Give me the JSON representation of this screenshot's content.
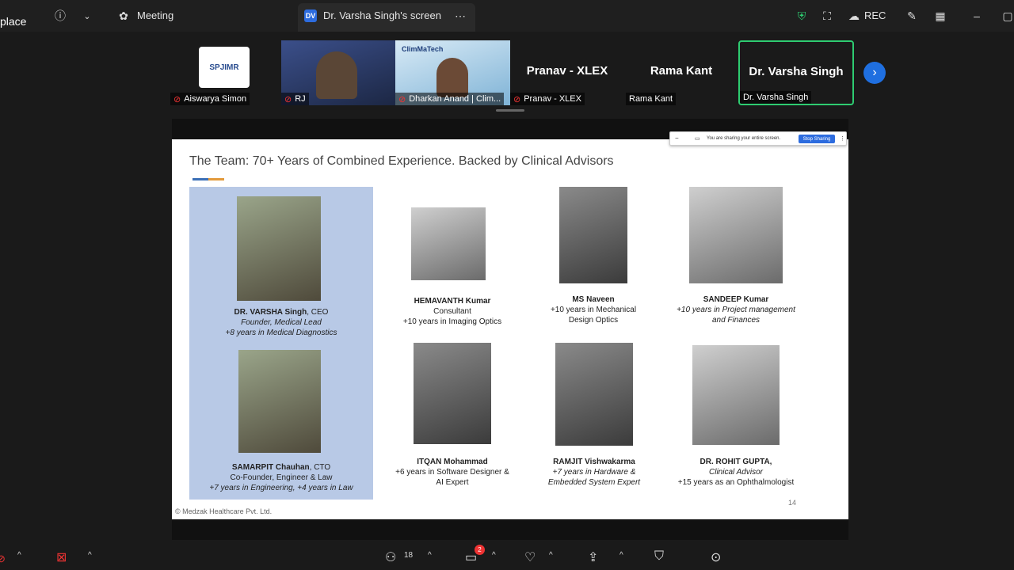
{
  "topbar": {
    "app_label": "place",
    "meeting_label": "Meeting",
    "screen_tab": {
      "badge": "DV",
      "label": "Dr.  Varsha Singh's screen"
    },
    "rec_label": "REC"
  },
  "participants": [
    {
      "name": "Aiswarya Simon",
      "muted": true,
      "logo_text": "SPJIMR"
    },
    {
      "name": "RJ",
      "muted": true
    },
    {
      "name": "Dharkan Anand | Clim...",
      "muted": true,
      "logo_text": "ClimMaTech"
    },
    {
      "name": "Pranav - XLEX",
      "muted": true,
      "big_name": "Pranav - XLEX"
    },
    {
      "name": "Rama Kant",
      "muted": false,
      "big_name": "Rama Kant"
    },
    {
      "name": "Dr.  Varsha Singh",
      "muted": false,
      "big_name": "Dr.  Varsha Singh",
      "active": true
    }
  ],
  "share_bar": {
    "text": "You are sharing your entire screen.",
    "stop_label": "Stop Sharing"
  },
  "slide": {
    "title": "The Team: 70+ Years of Combined Experience. Backed by Clinical Advisors",
    "footer": "© Medzak Healthcare Pvt. Ltd.",
    "page_number": "14",
    "lead": [
      {
        "name": "DR. VARSHA Singh",
        "role": ", CEO",
        "line2": "Founder, Medical Lead",
        "line3": "+8 years in Medical Diagnostics"
      },
      {
        "name": "SAMARPIT Chauhan",
        "role": ", CTO",
        "line2": "Co-Founder, Engineer & Law",
        "line3": "+7 years in Engineering, +4 years in Law"
      }
    ],
    "members": [
      {
        "name": "HEMAVANTH Kumar",
        "line2": "Consultant",
        "line3": "+10 years in Imaging Optics"
      },
      {
        "name": "MS Naveen",
        "line2": "+10 years in Mechanical",
        "line3": "Design Optics"
      },
      {
        "name": "SANDEEP Kumar",
        "line2": "+10 years in Project management",
        "line3": "and Finances"
      },
      {
        "name": "ITQAN Mohammad",
        "line2": "+6 years in Software Designer &",
        "line3": "AI Expert"
      },
      {
        "name": "RAMJIT Vishwakarma",
        "line2": "+7 years in Hardware &",
        "line3": "Embedded System Expert"
      },
      {
        "name": "DR. ROHIT GUPTA,",
        "line2": "Clinical Advisor",
        "line3": "+15 years as an Ophthalmologist"
      }
    ]
  },
  "bottombar": {
    "participants_count": "18",
    "chat_badge": "2"
  },
  "colors": {
    "active_border": "#2ecc71",
    "accent_blue": "#1f6fe0",
    "lead_panel": "#b8c9e6"
  }
}
